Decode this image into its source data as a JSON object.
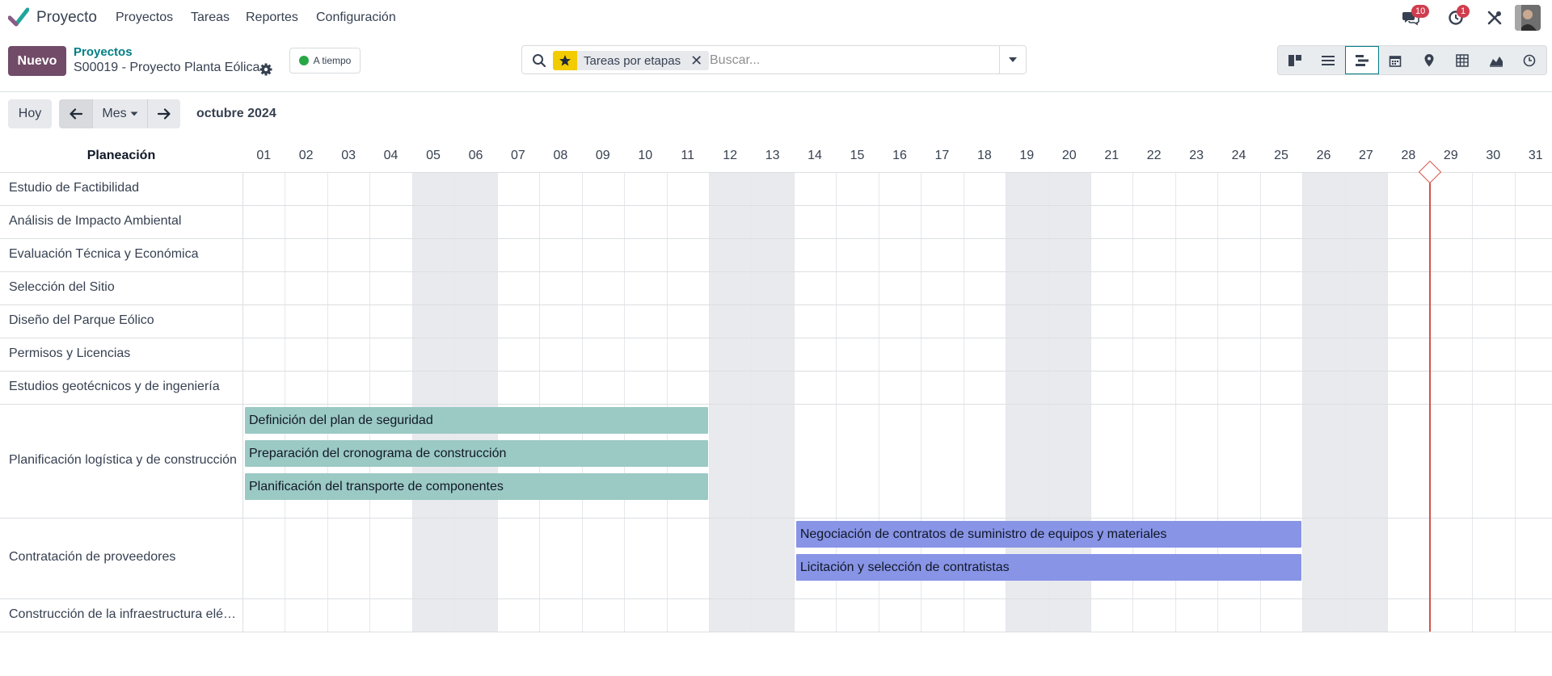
{
  "app": {
    "name": "Proyecto",
    "menu": [
      "Proyectos",
      "Tareas",
      "Reportes",
      "Configuración"
    ],
    "messages_count": "10",
    "activities_count": "1"
  },
  "control_panel": {
    "new_label": "Nuevo",
    "breadcrumb_parent": "Proyectos",
    "breadcrumb_current": "S00019 - Proyecto Planta Eólica",
    "status_label": "A tiempo",
    "status_color": "#28a745",
    "search": {
      "facet": "Tareas por etapas",
      "placeholder": "Buscar..."
    },
    "views": [
      "kanban-icon",
      "list-icon",
      "gantt-icon",
      "calendar-icon",
      "map-pin-icon",
      "pivot-icon",
      "graph-icon",
      "activity-icon"
    ],
    "active_view": "gantt-icon"
  },
  "gantt": {
    "today_label": "Hoy",
    "scale_label": "Mes",
    "period": "octubre 2024",
    "header_title": "Planeación",
    "days": [
      "01",
      "02",
      "03",
      "04",
      "05",
      "06",
      "07",
      "08",
      "09",
      "10",
      "11",
      "12",
      "13",
      "14",
      "15",
      "16",
      "17",
      "18",
      "19",
      "20",
      "21",
      "22",
      "23",
      "24",
      "25",
      "26",
      "27",
      "28",
      "29",
      "30",
      "31"
    ],
    "weekend_days": [
      "05",
      "06",
      "12",
      "13",
      "19",
      "20",
      "26",
      "27"
    ],
    "today_day": "29",
    "rows": [
      {
        "label": "Estudio de Factibilidad",
        "tasks": []
      },
      {
        "label": "Análisis de Impacto Ambiental",
        "tasks": []
      },
      {
        "label": "Evaluación Técnica y Económica",
        "tasks": []
      },
      {
        "label": "Selección del Sitio",
        "tasks": []
      },
      {
        "label": "Diseño del Parque Eólico",
        "tasks": []
      },
      {
        "label": "Permisos y Licencias",
        "tasks": []
      },
      {
        "label": "Estudios geotécnicos y de ingeniería",
        "tasks": []
      },
      {
        "label": "Planificación logística y de construcción",
        "tasks": [
          {
            "name": "Definición del plan de seguridad",
            "start": "01",
            "end": "11",
            "color": "#9bc9c4"
          },
          {
            "name": "Preparación del cronograma de construcción",
            "start": "01",
            "end": "11",
            "color": "#9bc9c4"
          },
          {
            "name": "Planificación del transporte de componentes",
            "start": "01",
            "end": "11",
            "color": "#9bc9c4"
          }
        ]
      },
      {
        "label": "Contratación de proveedores",
        "tasks": [
          {
            "name": "Negociación de contratos de suministro de equipos y materiales",
            "start": "14",
            "end": "25",
            "color": "#8894e6"
          },
          {
            "name": "Licitación y selección de contratistas",
            "start": "14",
            "end": "25",
            "color": "#8894e6"
          }
        ]
      },
      {
        "label": "Construcción de la infraestructura eléctrica",
        "tasks": []
      }
    ]
  }
}
